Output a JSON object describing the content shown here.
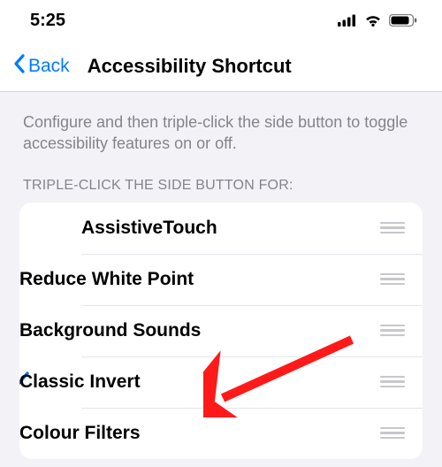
{
  "status": {
    "time": "5:25"
  },
  "nav": {
    "back_label": "Back",
    "title": "Accessibility Shortcut"
  },
  "content": {
    "description": "Configure and then triple-click the side button to toggle accessibility features on or off.",
    "section_header": "TRIPLE-CLICK THE SIDE BUTTON FOR:"
  },
  "options": [
    {
      "label": "AssistiveTouch",
      "selected": false
    },
    {
      "label": "Reduce White Point",
      "selected": false
    },
    {
      "label": "Background Sounds",
      "selected": false
    },
    {
      "label": "Classic Invert",
      "selected": true
    },
    {
      "label": "Colour Filters",
      "selected": false
    }
  ]
}
